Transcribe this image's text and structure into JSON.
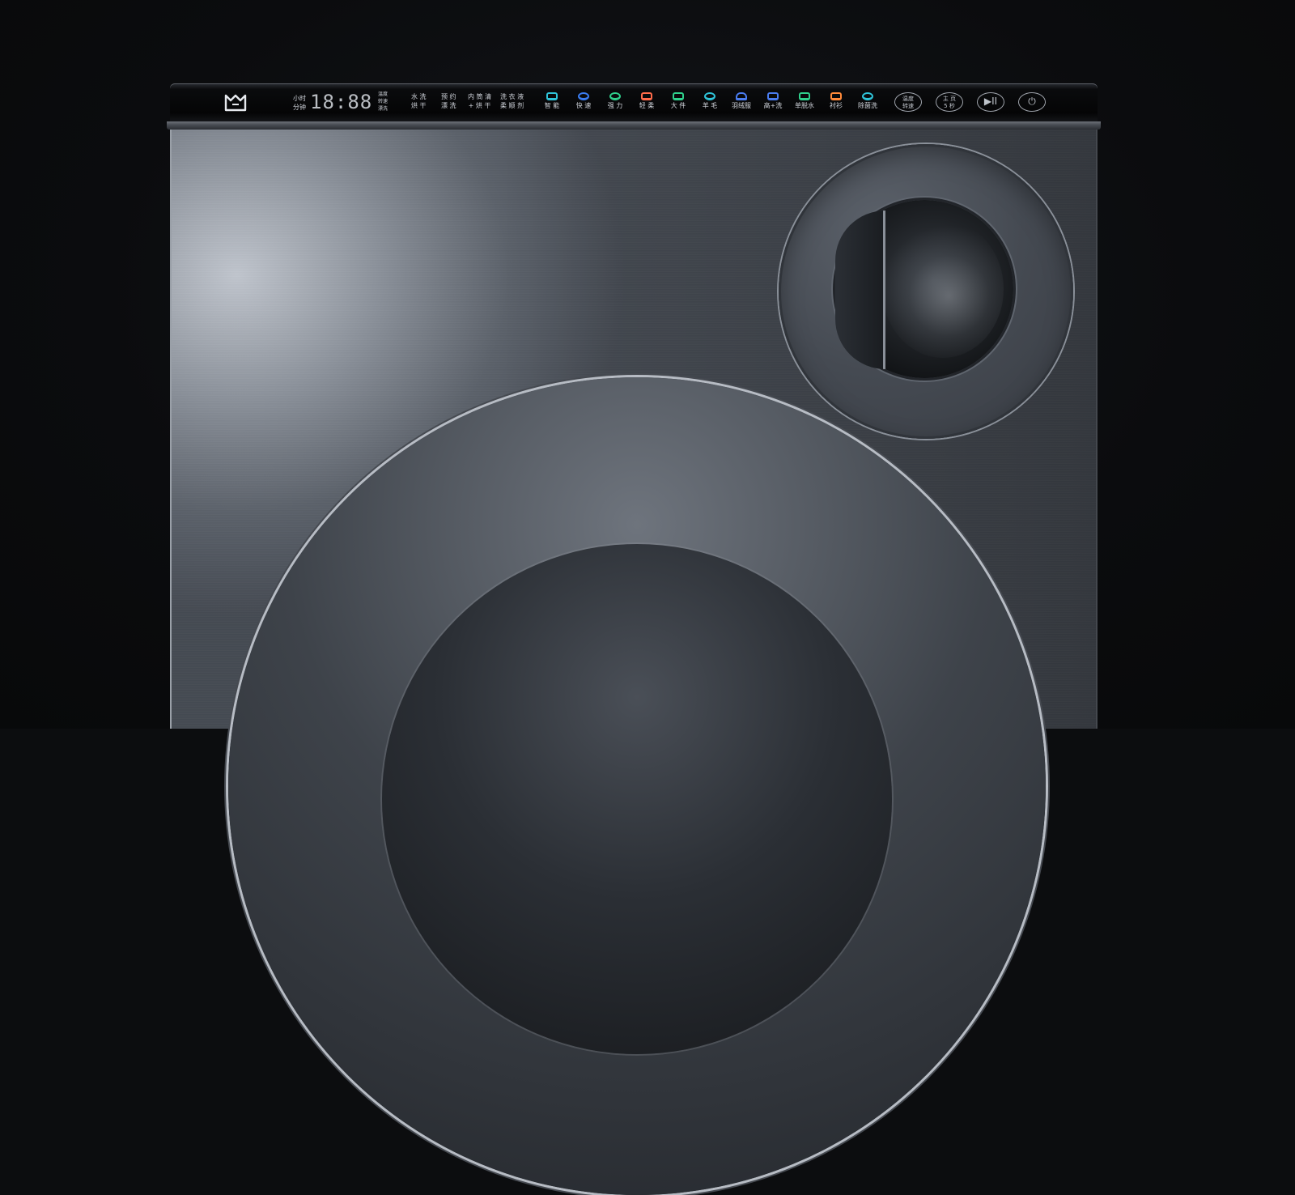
{
  "brand": {
    "logo_icon": "mi-home-logo-icon"
  },
  "display": {
    "left_labels": [
      "小时",
      "分钟"
    ],
    "digits": "18:88",
    "right_labels": [
      "温度",
      "转速",
      "漂洗"
    ]
  },
  "options": [
    {
      "top": "水 洗",
      "bottom": "烘 干"
    },
    {
      "top": "预 约",
      "bottom": "漂 洗"
    },
    {
      "top": "内 筒 清",
      "bottom": "+ 烘 干"
    },
    {
      "top": "洗 衣 液",
      "bottom": "柔 顺 剂"
    }
  ],
  "programs": [
    {
      "label": "智 能",
      "color": "#2fc3d8"
    },
    {
      "label": "快 速",
      "color": "#3a7cf0"
    },
    {
      "label": "强 力",
      "color": "#2fd08c"
    },
    {
      "label": "轻 柔",
      "color": "#ff6b4a"
    },
    {
      "label": "大 件",
      "color": "#2fd08c"
    },
    {
      "label": "羊 毛",
      "color": "#2fc3d8"
    },
    {
      "label": "羽绒服",
      "color": "#4a7cf0"
    },
    {
      "label": "高+洗",
      "color": "#4a7cf0"
    },
    {
      "label": "单脱水",
      "color": "#2fd08c"
    },
    {
      "label": "衬衫 ",
      "color": "#ff8a3a"
    },
    {
      "label": "除菌洗",
      "color": "#2fc3d8"
    }
  ],
  "controls": [
    {
      "label": "温度\n转速",
      "kind": "text"
    },
    {
      "label": "主 页\n5 秒",
      "kind": "text"
    },
    {
      "label": "▶II",
      "kind": "icon",
      "icon": "play-pause-icon"
    },
    {
      "label": "⏻",
      "kind": "icon",
      "icon": "power-icon"
    }
  ],
  "colors": {
    "body": "#5b616a",
    "panel": "#050506",
    "background": "#0c0d0f"
  }
}
